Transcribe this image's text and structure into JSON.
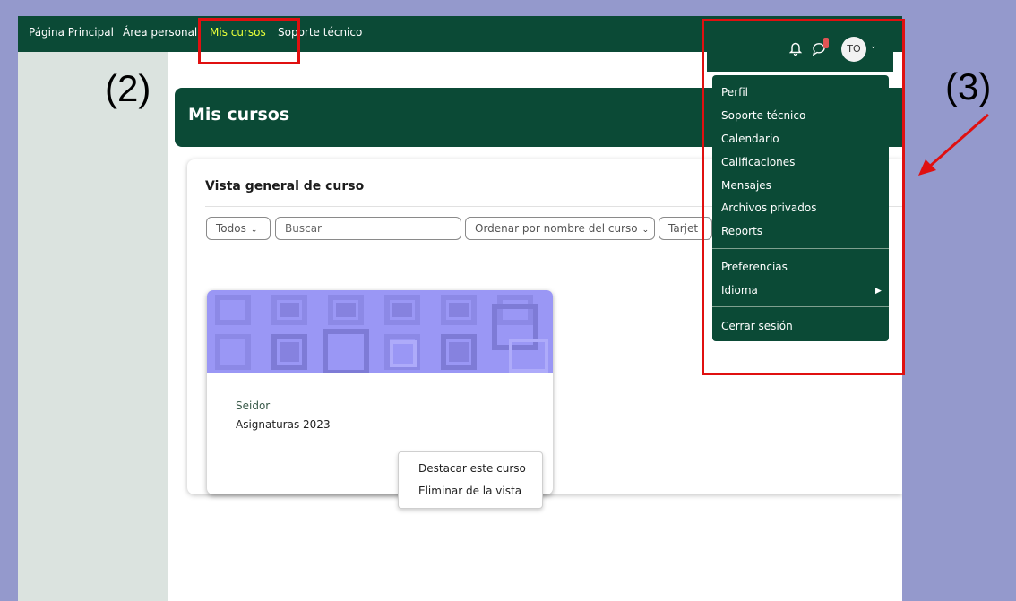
{
  "nav": {
    "items": [
      "Página Principal",
      "Área personal",
      "Mis cursos",
      "Soporte técnico"
    ]
  },
  "page": {
    "title": "Mis cursos"
  },
  "overview": {
    "title": "Vista general de curso",
    "filter_label": "Todos",
    "search_placeholder": "Buscar",
    "sort_label": "Ordenar por nombre del curso",
    "view_label": "Tarjet"
  },
  "course": {
    "category": "Seidor",
    "name": "Asignaturas 2023"
  },
  "course_menu": {
    "items": [
      "Destacar este curso",
      "Eliminar de la vista"
    ]
  },
  "user": {
    "initials": "TO",
    "menu": {
      "group1": [
        "Perfil",
        "Soporte técnico",
        "Calendario",
        "Calificaciones",
        "Mensajes",
        "Archivos privados",
        "Reports"
      ],
      "group2": [
        "Preferencias",
        "Idioma"
      ],
      "logout": "Cerrar sesión"
    }
  },
  "annotations": {
    "label2": "(2)",
    "label3": "(3)"
  },
  "peek": {
    "a": "d",
    "b": "sp",
    "c": "ne"
  },
  "colors": {
    "brand": "#0b4a36",
    "highlight": "#e8ff3a",
    "annotation": "#e01010",
    "card_pattern": "#9a97f5"
  }
}
